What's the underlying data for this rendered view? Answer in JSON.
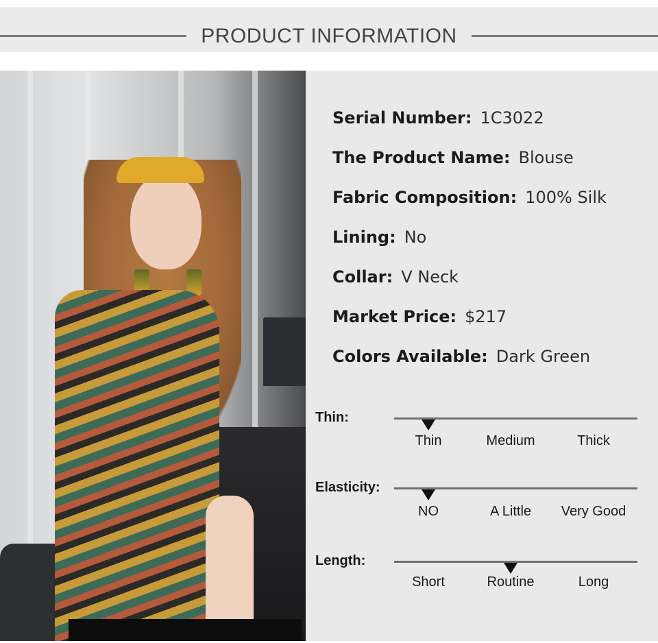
{
  "header": {
    "title": "PRODUCT INFORMATION"
  },
  "specs": [
    {
      "label": "Serial Number:",
      "value": "1C3022"
    },
    {
      "label": "The Product Name:",
      "value": "Blouse"
    },
    {
      "label": "Fabric Composition:",
      "value": "100% Silk"
    },
    {
      "label": "Lining:",
      "value": "No"
    },
    {
      "label": "Collar:",
      "value": "V Neck"
    },
    {
      "label": "Market Price:",
      "value": "$217"
    },
    {
      "label": "Colors Available:",
      "value": "Dark Green"
    }
  ],
  "scales": [
    {
      "label": "Thin:",
      "options": [
        "Thin",
        "Medium",
        "Thick"
      ],
      "selected": "Thin"
    },
    {
      "label": "Elasticity:",
      "options": [
        "NO",
        "A Little",
        "Very Good"
      ],
      "selected": "NO"
    },
    {
      "label": "Length:",
      "options": [
        "Short",
        "Routine",
        "Long"
      ],
      "selected": "Routine"
    }
  ],
  "colors": {
    "header_bg": "#ebebeb",
    "panel_bg": "#e9e9e9",
    "rule": "#7a7a7a",
    "marker": "#111111"
  }
}
